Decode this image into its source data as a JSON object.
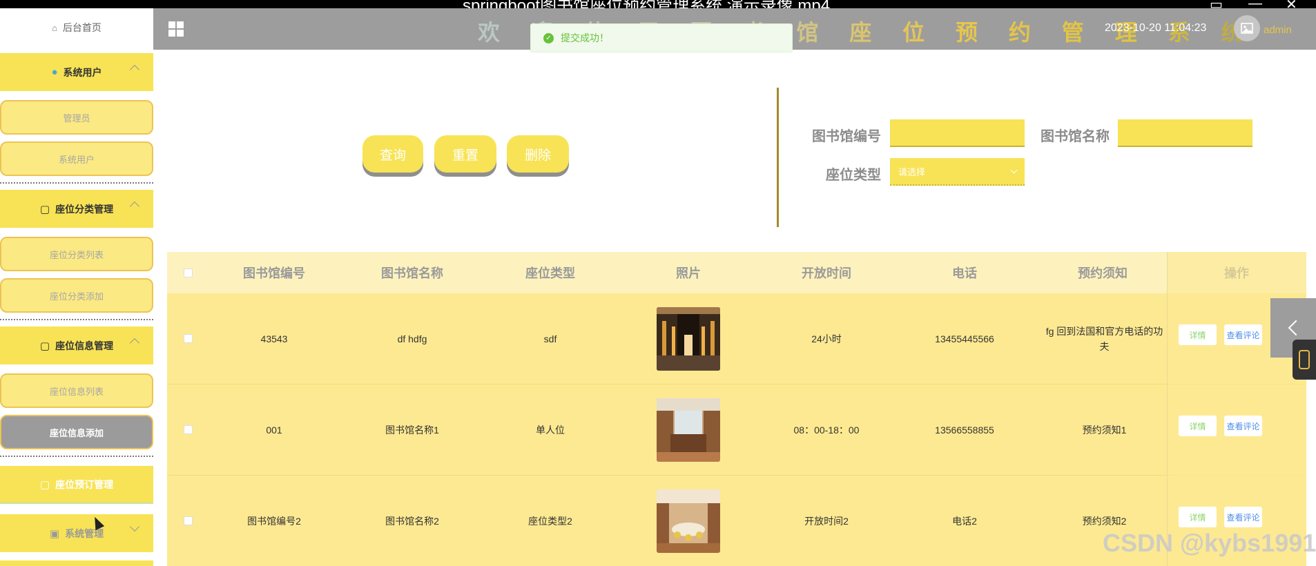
{
  "window": {
    "title": "springboot图书馆座位预约管理系统 演示录像.mp4"
  },
  "header": {
    "welcome": "欢 迎 使 用 图 书 馆 座 位 预 约 管 理 系 统",
    "datetime": "2023-10-20 11:04:23",
    "username": "admin"
  },
  "toast": {
    "message": "提交成功！",
    "color": "#67c23a"
  },
  "sidebar": {
    "home": "后台首页",
    "groups": [
      {
        "label": "系统用户",
        "icon": "user-icon",
        "items": [
          "管理员",
          "系统用户"
        ]
      },
      {
        "label": "座位分类管理",
        "icon": "folder-icon",
        "items": [
          "座位分类列表",
          "座位分类添加"
        ]
      },
      {
        "label": "座位信息管理",
        "icon": "folder-icon",
        "items": [
          "座位信息列表",
          "座位信息添加"
        ],
        "active_item": "座位信息添加"
      },
      {
        "label": "座位预订管理",
        "icon": "folder-icon"
      },
      {
        "label": "系统管理",
        "icon": "image-icon"
      }
    ]
  },
  "search": {
    "buttons": {
      "query": "查询",
      "reset": "重置",
      "delete": "删除"
    },
    "fields": {
      "library_code": {
        "label": "图书馆编号",
        "value": ""
      },
      "library_name": {
        "label": "图书馆名称",
        "value": ""
      },
      "seat_type": {
        "label": "座位类型",
        "selected": "请选择"
      }
    }
  },
  "table": {
    "columns": [
      "图书馆编号",
      "图书馆名称",
      "座位类型",
      "照片",
      "开放时间",
      "电话",
      "预约须知",
      "操作"
    ],
    "rows": [
      {
        "code": "43543",
        "name": "df hdfg",
        "type": "sdf",
        "photo": "library-interior-photo",
        "hours": "24小时",
        "phone": "13455445566",
        "notice": "fg 回到法国和官方电话的功夫"
      },
      {
        "code": "001",
        "name": "图书馆名称1",
        "type": "单人位",
        "photo": "meeting-room-photo",
        "hours": "08：00-18：00",
        "phone": "13566558855",
        "notice": "预约须知1"
      },
      {
        "code": "图书馆编号2",
        "name": "图书馆名称2",
        "type": "座位类型2",
        "photo": "reading-room-photo",
        "hours": "开放时间2",
        "phone": "电话2",
        "notice": "预约须知2"
      }
    ],
    "actions": {
      "detail": "详情",
      "comments": "查看评论"
    }
  },
  "watermark": "CSDN @kybs1991",
  "colors": {
    "accent": "#f7e355",
    "header": "#9d9d9d",
    "row": "#fde992",
    "head": "#fdf2bd"
  }
}
